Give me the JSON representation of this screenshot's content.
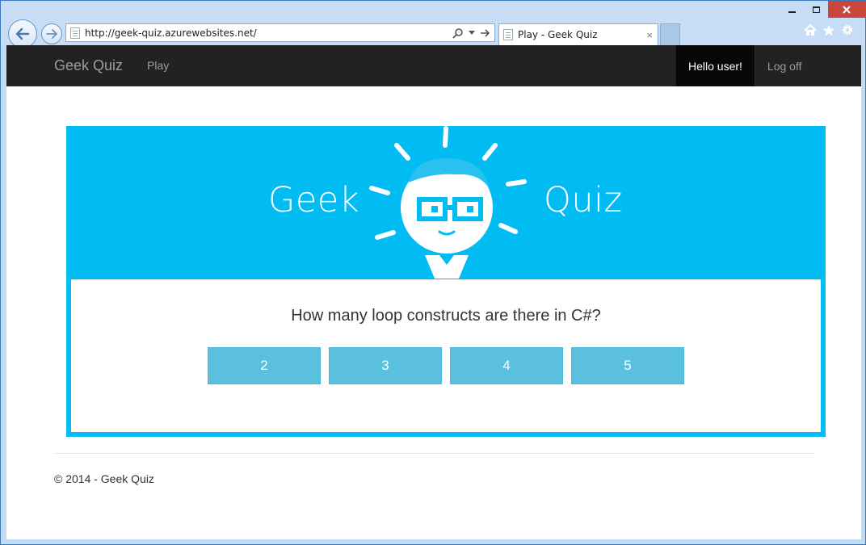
{
  "browser": {
    "url": "http://geek-quiz.azurewebsites.net/",
    "tab_title": "Play - Geek Quiz",
    "tab_close": "×"
  },
  "navbar": {
    "brand": "Geek Quiz",
    "links": {
      "play": "Play"
    },
    "greeting": "Hello user!",
    "logoff": "Log off"
  },
  "quiz": {
    "logo_left": "Geek",
    "logo_right": "Quiz",
    "question": "How many loop constructs are there in C#?",
    "options": [
      "2",
      "3",
      "4",
      "5"
    ]
  },
  "footer": {
    "copyright": "© 2014 - Geek Quiz"
  },
  "colors": {
    "panel": "#00bcf2",
    "option_button": "#5bc0de",
    "navbar": "#222222"
  },
  "icons": {
    "back": "arrow-left-icon",
    "forward": "arrow-right-icon",
    "search": "search-icon",
    "refresh": "refresh-icon",
    "home": "home-icon",
    "favorites": "star-icon",
    "settings": "gear-icon"
  }
}
